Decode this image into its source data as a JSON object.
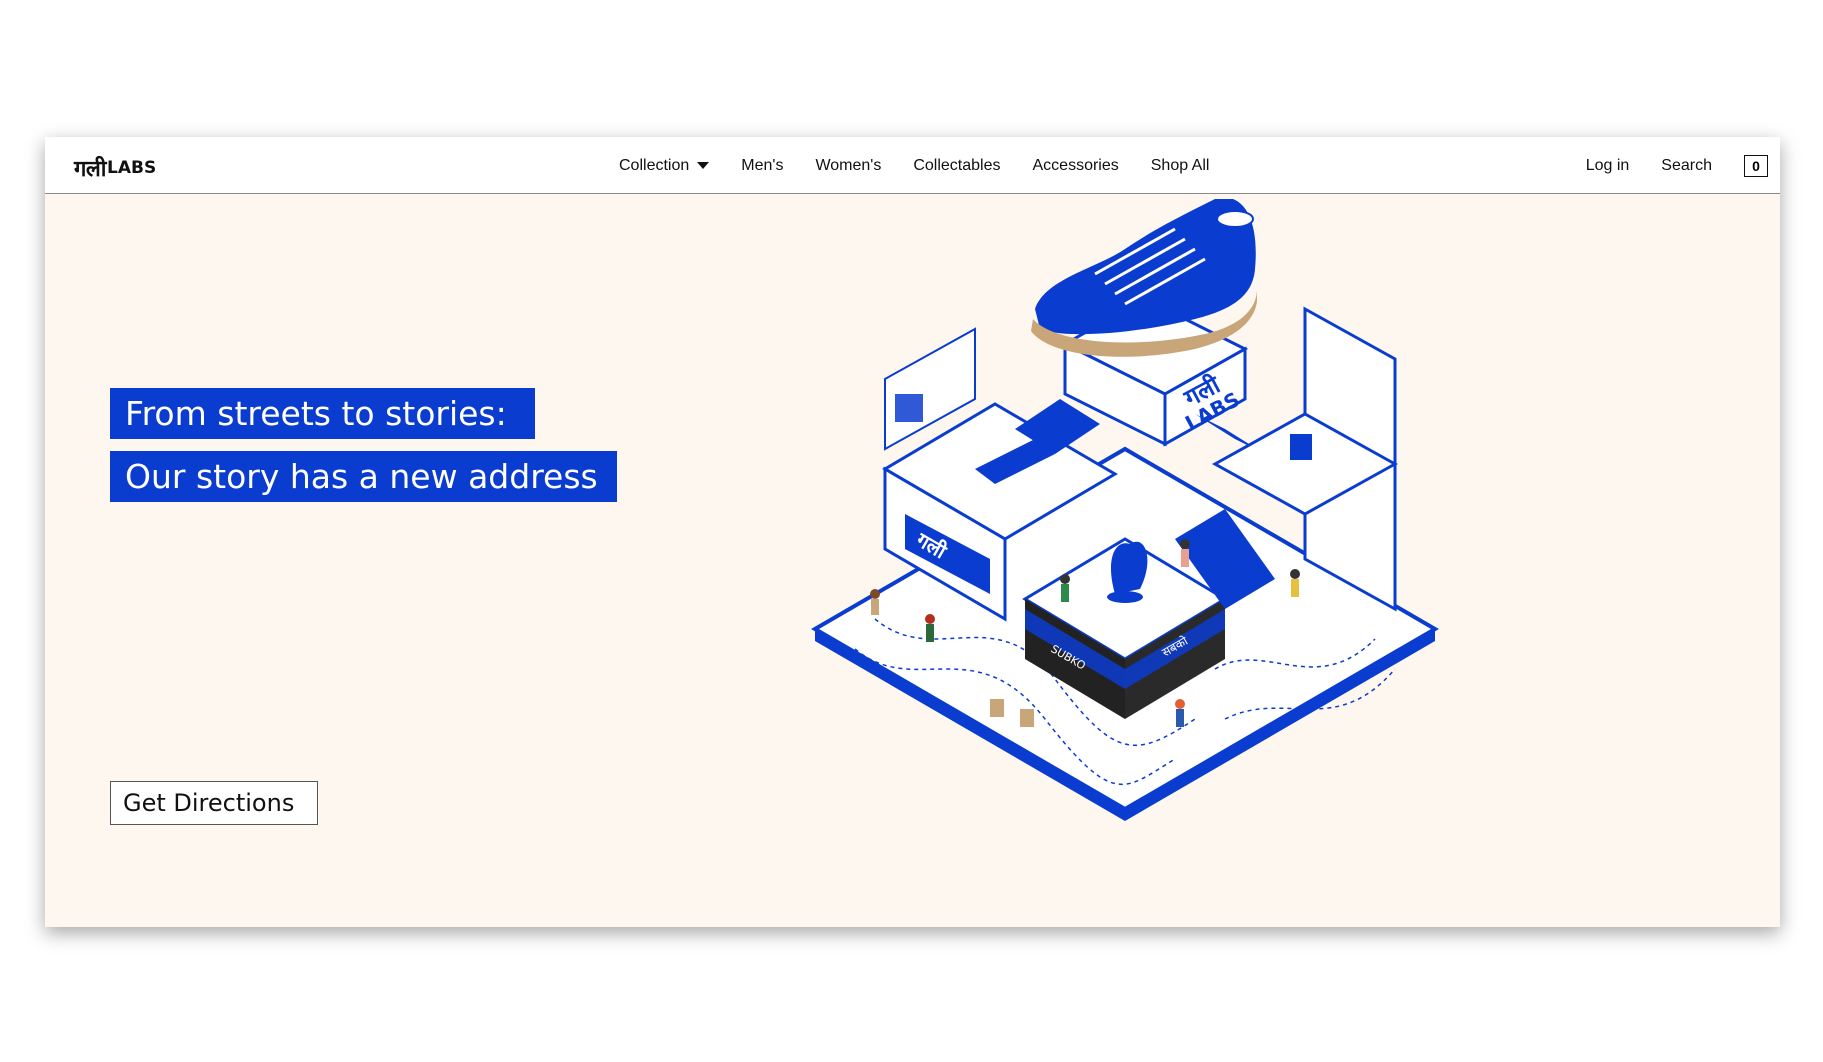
{
  "brand": {
    "logo_dev": "गली",
    "logo_latin": "LABS"
  },
  "nav": {
    "links": [
      "Collection",
      "Men's",
      "Women's",
      "Collectables",
      "Accessories",
      "Shop All"
    ],
    "login": "Log in",
    "search": "Search",
    "cart_count": "0"
  },
  "hero": {
    "line1": "From streets to stories:",
    "line2": "Our story has a new address",
    "button": "Get Directions"
  },
  "illustration": {
    "sign_dev": "गली",
    "sign_latin": "LABS",
    "store_sign_left": "SUBKO",
    "store_sign_right": "सबको"
  },
  "colors": {
    "accent": "#0a3ccf",
    "background": "#fdf7ef",
    "shoe_sole": "#c9a57a"
  }
}
